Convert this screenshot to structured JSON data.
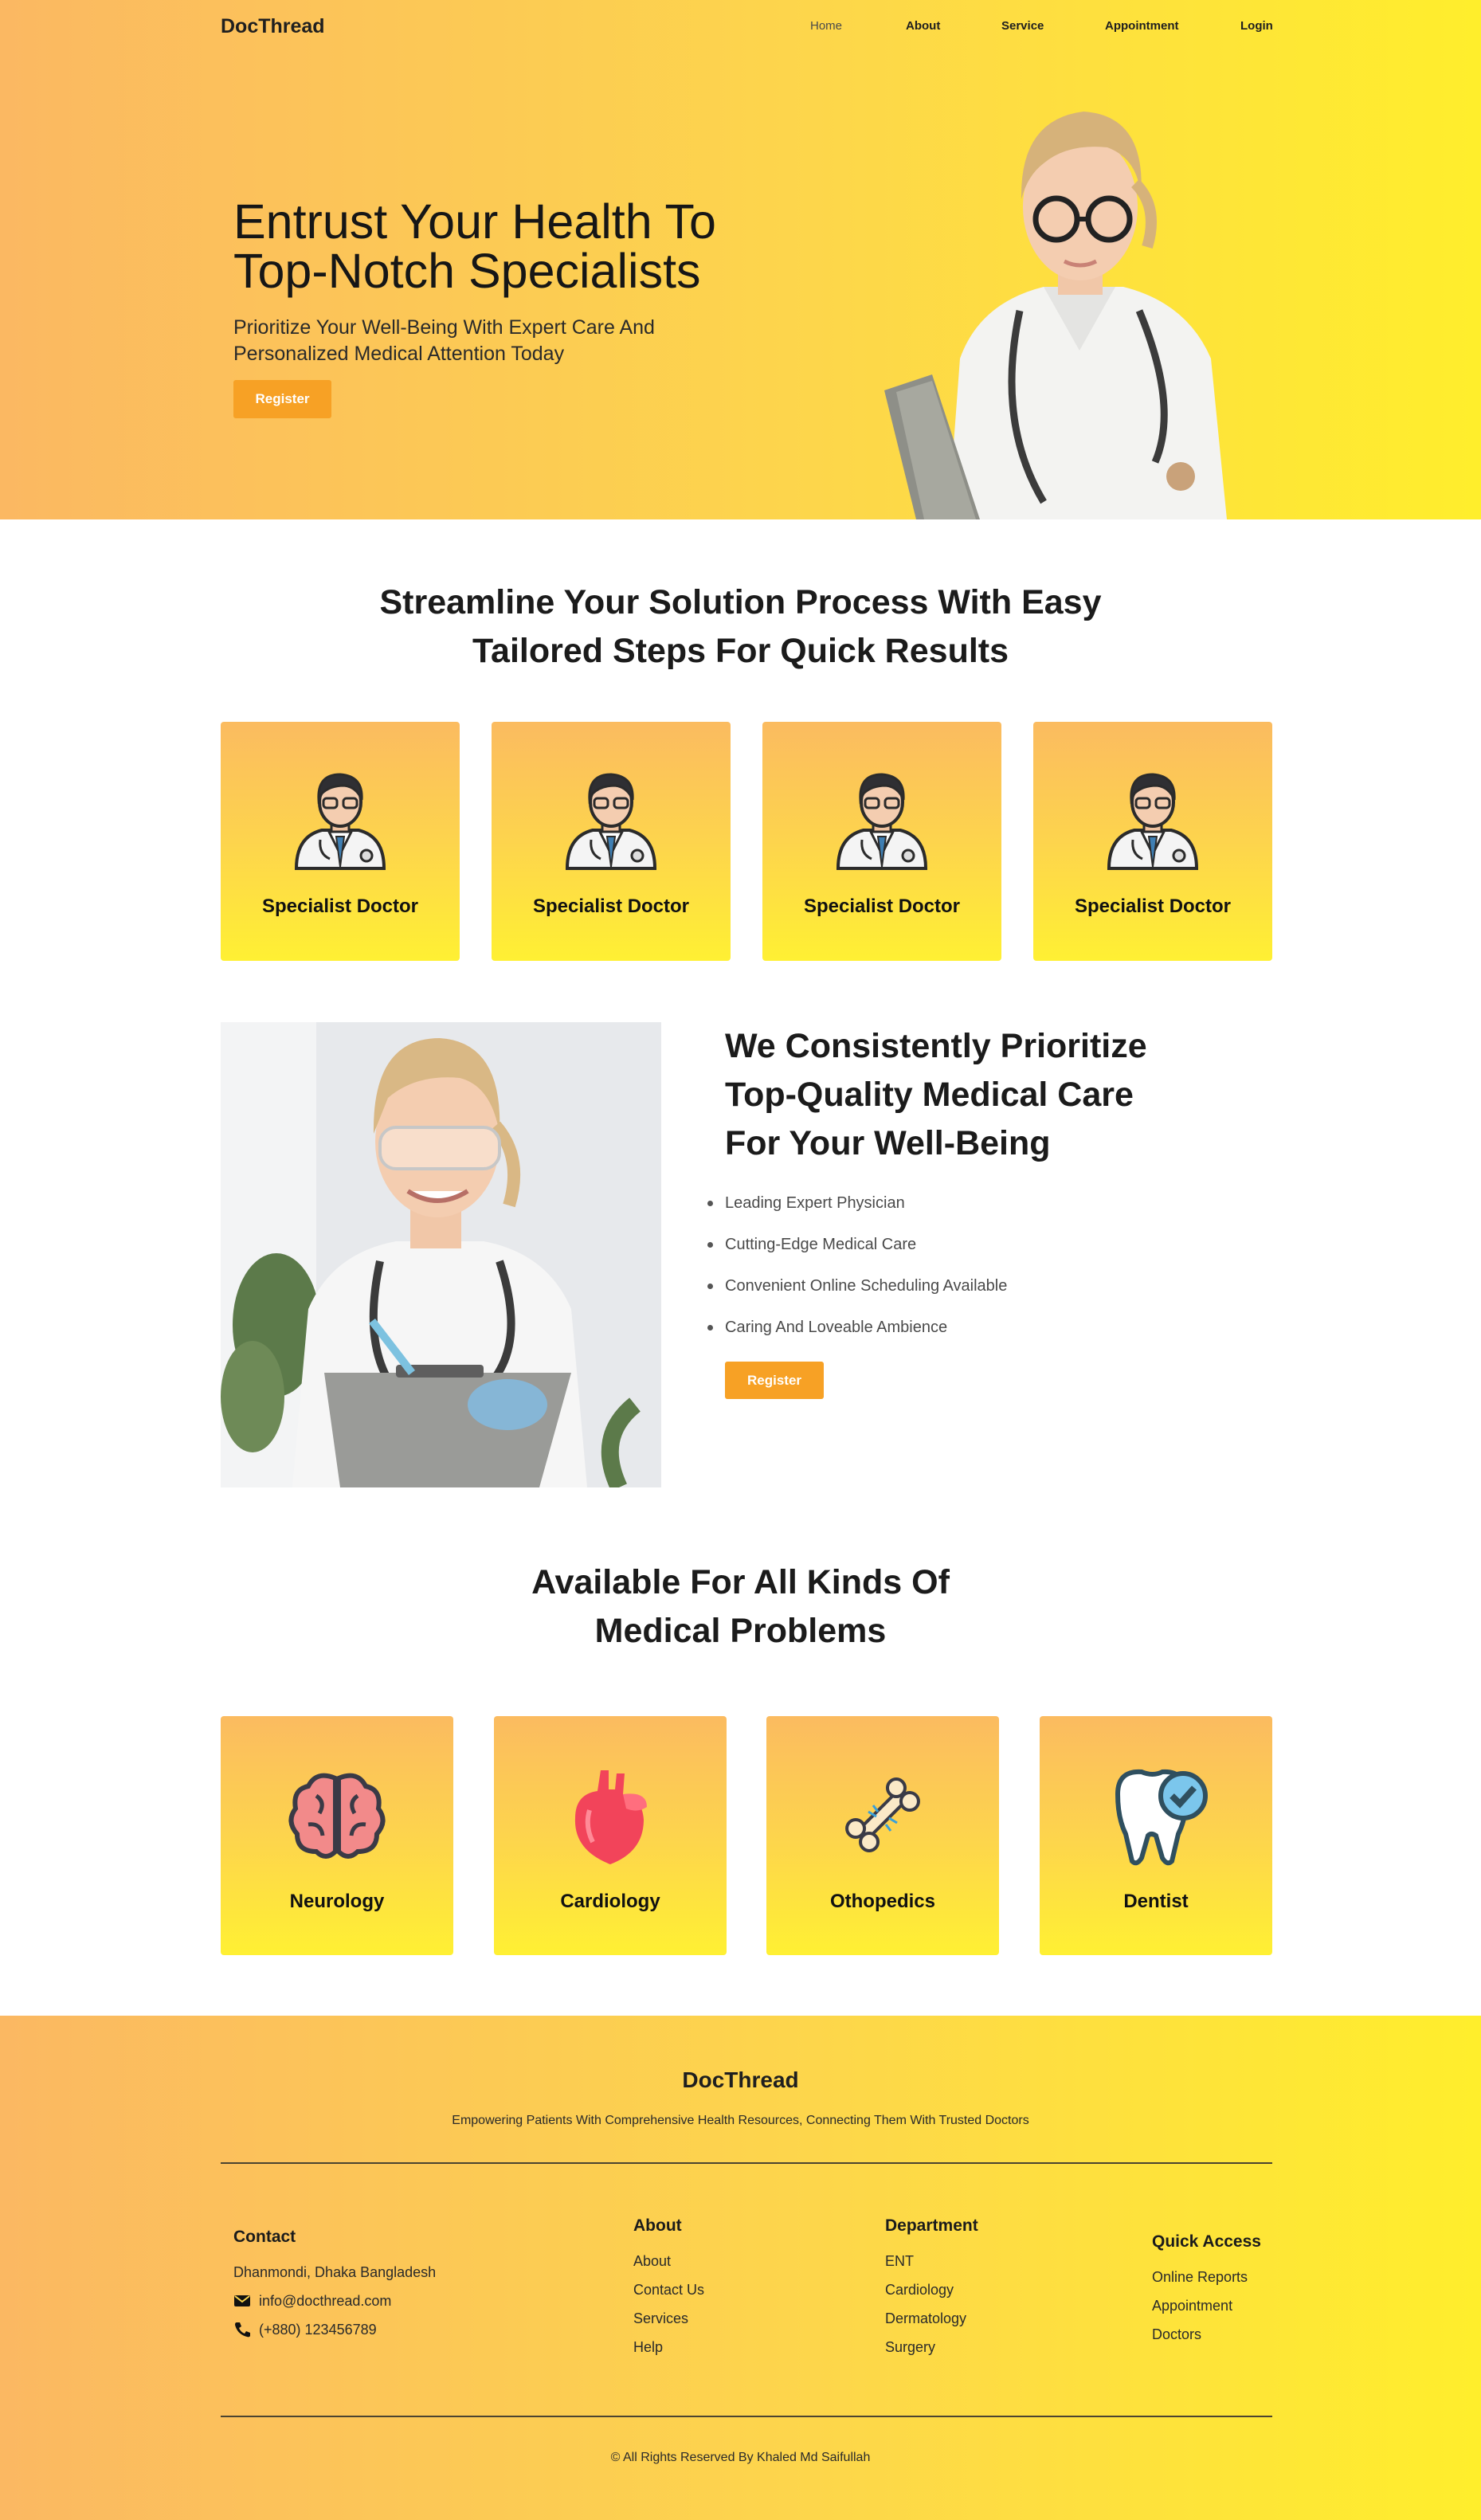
{
  "nav": {
    "brand": "DocThread",
    "items": [
      {
        "label": "Home"
      },
      {
        "label": "About"
      },
      {
        "label": "Service"
      },
      {
        "label": "Appointment"
      },
      {
        "label": "Login"
      }
    ]
  },
  "hero": {
    "title_line1": "Entrust Your Health To",
    "title_line2": "Top-Notch Specialists",
    "subtitle_line1": "Prioritize Your Well-Being With Expert Care And",
    "subtitle_line2": "Personalized Medical Attention Today",
    "button": "Register"
  },
  "steps": {
    "title_line1": "Streamline Your Solution Process With Easy",
    "title_line2": "Tailored Steps For Quick Results",
    "cards": [
      {
        "label": "Specialist Doctor",
        "icon": "doctor-avatar-icon"
      },
      {
        "label": "Specialist Doctor",
        "icon": "doctor-avatar-icon"
      },
      {
        "label": "Specialist Doctor",
        "icon": "doctor-avatar-icon"
      },
      {
        "label": "Specialist Doctor",
        "icon": "doctor-avatar-icon"
      }
    ]
  },
  "about": {
    "title_line1": "We Consistently Prioritize",
    "title_line2": "Top-Quality Medical Care",
    "title_line3": "For Your Well-Being",
    "list": [
      "Leading Expert Physician",
      "Cutting-Edge Medical Care",
      "Convenient Online Scheduling Available",
      "Caring And Loveable Ambience"
    ],
    "button": "Register"
  },
  "specialties": {
    "title_line1": "Available For All Kinds Of",
    "title_line2": "Medical Problems",
    "cards": [
      {
        "label": "Neurology",
        "icon": "brain-icon"
      },
      {
        "label": "Cardiology",
        "icon": "heart-icon"
      },
      {
        "label": "Othopedics",
        "icon": "bone-icon"
      },
      {
        "label": "Dentist",
        "icon": "tooth-icon"
      }
    ]
  },
  "footer": {
    "brand": "DocThread",
    "tagline": "Empowering Patients With Comprehensive Health Resources, Connecting Them With Trusted Doctors",
    "contact": {
      "heading": "Contact",
      "address": "Dhanmondi, Dhaka Bangladesh",
      "email": "info@docthread.com",
      "phone": "(+880) 123456789"
    },
    "about": {
      "heading": "About",
      "links": [
        "About",
        "Contact Us",
        "Services",
        "Help"
      ]
    },
    "department": {
      "heading": "Department",
      "links": [
        "ENT",
        "Cardiology",
        "Dermatology",
        "Surgery"
      ]
    },
    "quick": {
      "heading": "Quick Access",
      "links": [
        "Online Reports",
        "Appointment",
        "Doctors"
      ]
    },
    "copyright": "© All Rights Reserved By Khaled Md Saifullah"
  },
  "colors": {
    "gradient_start": "#fbb862",
    "gradient_end": "#ffee2c",
    "accent_button": "#f7a125"
  }
}
